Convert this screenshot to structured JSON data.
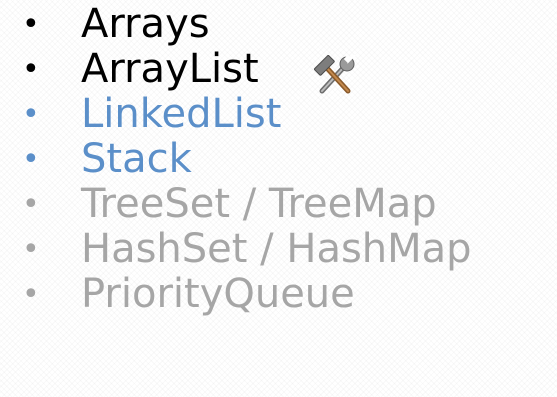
{
  "slide": {
    "items": [
      {
        "bullet": "•",
        "label": "Arrays",
        "color": "#000000"
      },
      {
        "bullet": "•",
        "label": "ArrayList",
        "color": "#000000",
        "icon": "hammer-wrench-icon"
      },
      {
        "bullet": "•",
        "label": "LinkedList",
        "color": "#5b8fc9"
      },
      {
        "bullet": "•",
        "label": "Stack",
        "color": "#5b8fc9"
      },
      {
        "bullet": "•",
        "label": "TreeSet / TreeMap",
        "color": "#a6a6a6"
      },
      {
        "bullet": "•",
        "label": "HashSet / HashMap",
        "color": "#a6a6a6"
      },
      {
        "bullet": "•",
        "label": "PriorityQueue",
        "color": "#a6a6a6"
      }
    ]
  }
}
